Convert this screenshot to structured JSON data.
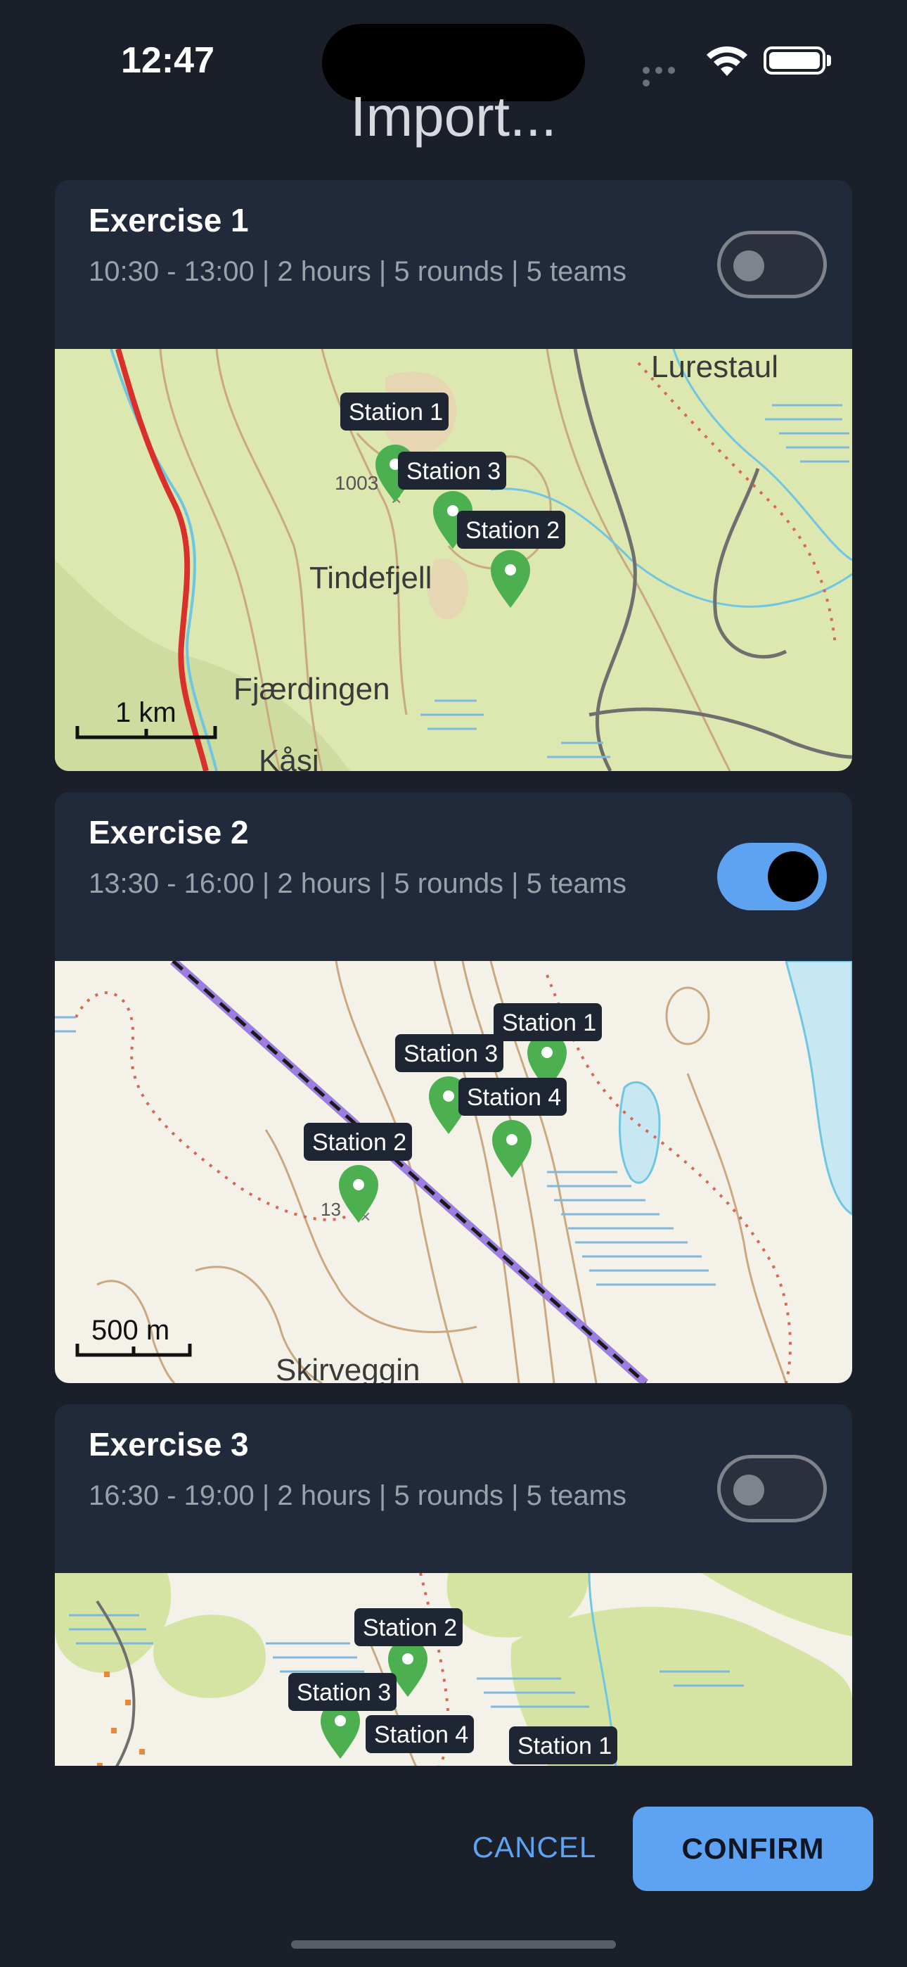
{
  "status_bar": {
    "time": "12:47"
  },
  "dialog": {
    "title": "Import...",
    "exercises": [
      {
        "name": "Exercise 1",
        "details": "10:30 - 13:00 | 2 hours | 5 rounds | 5 teams",
        "enabled": false,
        "map": {
          "scale_label": "1 km",
          "place_names": [
            "Lurestaul",
            "Tindefjell",
            "Fjærdingen",
            "Kåsi"
          ],
          "elevation_label": "1003",
          "stations": [
            "Station 1",
            "Station 3",
            "Station 2"
          ]
        }
      },
      {
        "name": "Exercise 2",
        "details": "13:30 - 16:00 | 2 hours | 5 rounds | 5 teams",
        "enabled": true,
        "map": {
          "scale_label": "500 m",
          "place_names": [
            "Skirveggin"
          ],
          "elevation_label": "13",
          "stations": [
            "Station 1",
            "Station 3",
            "Station 4",
            "Station 2"
          ]
        }
      },
      {
        "name": "Exercise 3",
        "details": "16:30 - 19:00 | 2 hours | 5 rounds | 5 teams",
        "enabled": false,
        "map": {
          "stations": [
            "Station 2",
            "Station 3",
            "Station 4",
            "Station 1"
          ]
        }
      }
    ],
    "cancel_label": "CANCEL",
    "confirm_label": "CONFIRM"
  },
  "colors": {
    "accent": "#5ea3f2",
    "card_bg": "#202a3a",
    "page_bg": "#1a1f29",
    "pin_green": "#4caf50"
  }
}
